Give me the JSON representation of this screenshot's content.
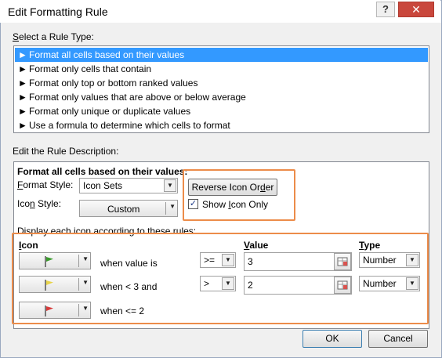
{
  "window": {
    "title": "Edit Formatting Rule",
    "help_label": "?",
    "close_label": "✕"
  },
  "rule_type": {
    "heading": "Select a Rule Type:",
    "items": [
      {
        "label": "Format all cells based on their values",
        "selected": true
      },
      {
        "label": "Format only cells that contain"
      },
      {
        "label": "Format only top or bottom ranked values"
      },
      {
        "label": "Format only values that are above or below average"
      },
      {
        "label": "Format only unique or duplicate values"
      },
      {
        "label": "Use a formula to determine which cells to format"
      }
    ]
  },
  "description": {
    "heading": "Edit the Rule Description:",
    "subheading": "Format all cells based on their values:",
    "format_style_label": "Format Style:",
    "format_style_value": "Icon Sets",
    "icon_style_label": "Icon Style:",
    "icon_style_value": "Custom",
    "reverse_button": "Reverse Icon Order",
    "show_icon_only_label": "Show Icon Only",
    "show_icon_only_checked": true,
    "rules_heading": "Display each icon according to these rules:",
    "columns": {
      "icon": "Icon",
      "value": "Value",
      "type": "Type"
    },
    "rows": [
      {
        "icon": "green-flag",
        "condition": "when value is",
        "operator": ">=",
        "value": "3",
        "type": "Number"
      },
      {
        "icon": "yellow-flag",
        "condition": "when < 3 and",
        "operator": ">",
        "value": "2",
        "type": "Number"
      },
      {
        "icon": "red-flag",
        "condition": "when <= 2"
      }
    ],
    "flag_colors": {
      "green-flag": "#3a9b2c",
      "yellow-flag": "#e8d44a",
      "red-flag": "#d83a3a"
    }
  },
  "buttons": {
    "ok": "OK",
    "cancel": "Cancel"
  },
  "accent": "#ec8c4a"
}
